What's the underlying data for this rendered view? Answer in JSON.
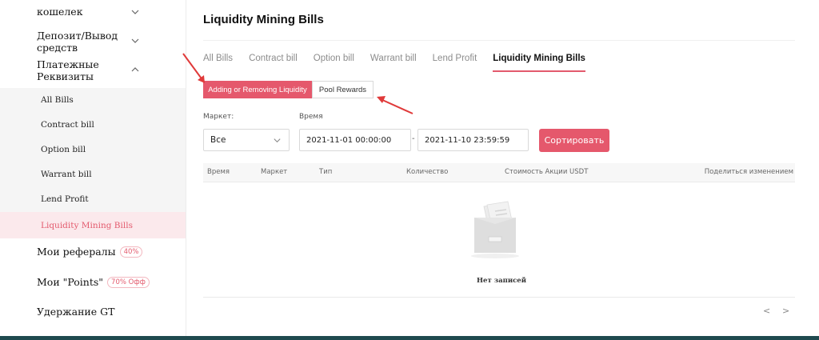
{
  "sidebar": {
    "top_items": [
      {
        "label": "кошелек",
        "expanded": false
      },
      {
        "label": "Депозит/Вывод средств",
        "expanded": false
      },
      {
        "label": "Платежные Реквизиты",
        "expanded": true
      }
    ],
    "sub_items": [
      {
        "label": "All Bills",
        "active": false
      },
      {
        "label": "Contract bill",
        "active": false
      },
      {
        "label": "Option bill",
        "active": false
      },
      {
        "label": "Warrant bill",
        "active": false
      },
      {
        "label": "Lend Profit",
        "active": false
      },
      {
        "label": "Liquidity Mining Bills",
        "active": true
      }
    ],
    "bottom_items": [
      {
        "label": "Мои рефералы",
        "badge": "40%"
      },
      {
        "label": "Мои \"Points\"",
        "badge": "70% Офф"
      },
      {
        "label": "Удержание GT",
        "badge": ""
      }
    ]
  },
  "main": {
    "title": "Liquidity Mining Bills",
    "tabs": [
      {
        "label": "All Bills",
        "active": false
      },
      {
        "label": "Contract bill",
        "active": false
      },
      {
        "label": "Option bill",
        "active": false
      },
      {
        "label": "Warrant bill",
        "active": false
      },
      {
        "label": "Lend Profit",
        "active": false
      },
      {
        "label": "Liquidity Mining Bills",
        "active": true
      }
    ],
    "sub_tabs": {
      "primary": "Adding or Removing Liquidity",
      "secondary": "Pool Rewards"
    },
    "filters": {
      "market_label": "Маркет:",
      "market_value": "Все",
      "time_label": "Время",
      "start": "2021-11-01 00:00:00",
      "separator": "-",
      "end": "2021-11-10 23:59:59",
      "sort_label": "Сортировать"
    },
    "table": {
      "columns": [
        "Время",
        "Маркет",
        "Тип",
        "Количество",
        "Стоимость Акции USDT",
        "Поделиться изменением"
      ],
      "empty_text": "Нет записей"
    },
    "pager": {
      "prev": "<",
      "next": ">"
    }
  },
  "colors": {
    "accent": "#e5586c",
    "active_bg": "#fbe9ec",
    "annotation_arrow": "#e03a3a",
    "bottom_bar": "#1f4a4f"
  }
}
